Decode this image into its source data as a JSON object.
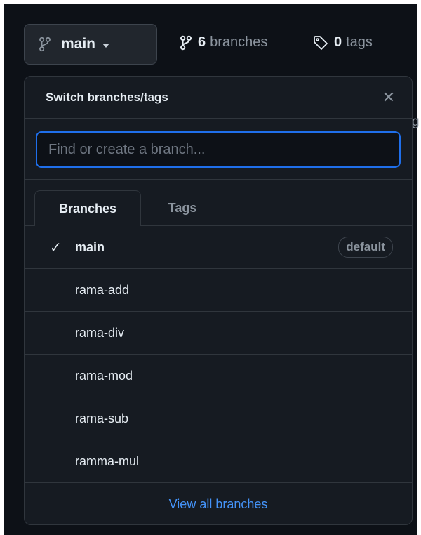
{
  "branch_button": {
    "label": "main"
  },
  "stats": {
    "branches_count": "6",
    "branches_label": "branches",
    "tags_count": "0",
    "tags_label": "tags"
  },
  "background_hint": "g",
  "dropdown": {
    "title": "Switch branches/tags",
    "close_glyph": "✕",
    "search_placeholder": "Find or create a branch...",
    "tabs": [
      {
        "label": "Branches",
        "active": true
      },
      {
        "label": "Tags",
        "active": false
      }
    ],
    "branches": [
      {
        "name": "main",
        "selected": true,
        "badge": "default"
      },
      {
        "name": "rama-add"
      },
      {
        "name": "rama-div"
      },
      {
        "name": "rama-mod"
      },
      {
        "name": "rama-sub"
      },
      {
        "name": "ramma-mul"
      }
    ],
    "check_glyph": "✓",
    "footer_link": "View all branches"
  },
  "colors": {
    "background": "#0d1117",
    "panel": "#161b22",
    "border": "#30363d",
    "accent_blue": "#1f6feb",
    "link_blue": "#4493f8",
    "muted": "#8b949e"
  },
  "icons": {
    "branch_button": "git-branch-icon",
    "branches_stat": "git-branch-icon",
    "tags_stat": "tag-icon",
    "selected": "check-icon"
  }
}
